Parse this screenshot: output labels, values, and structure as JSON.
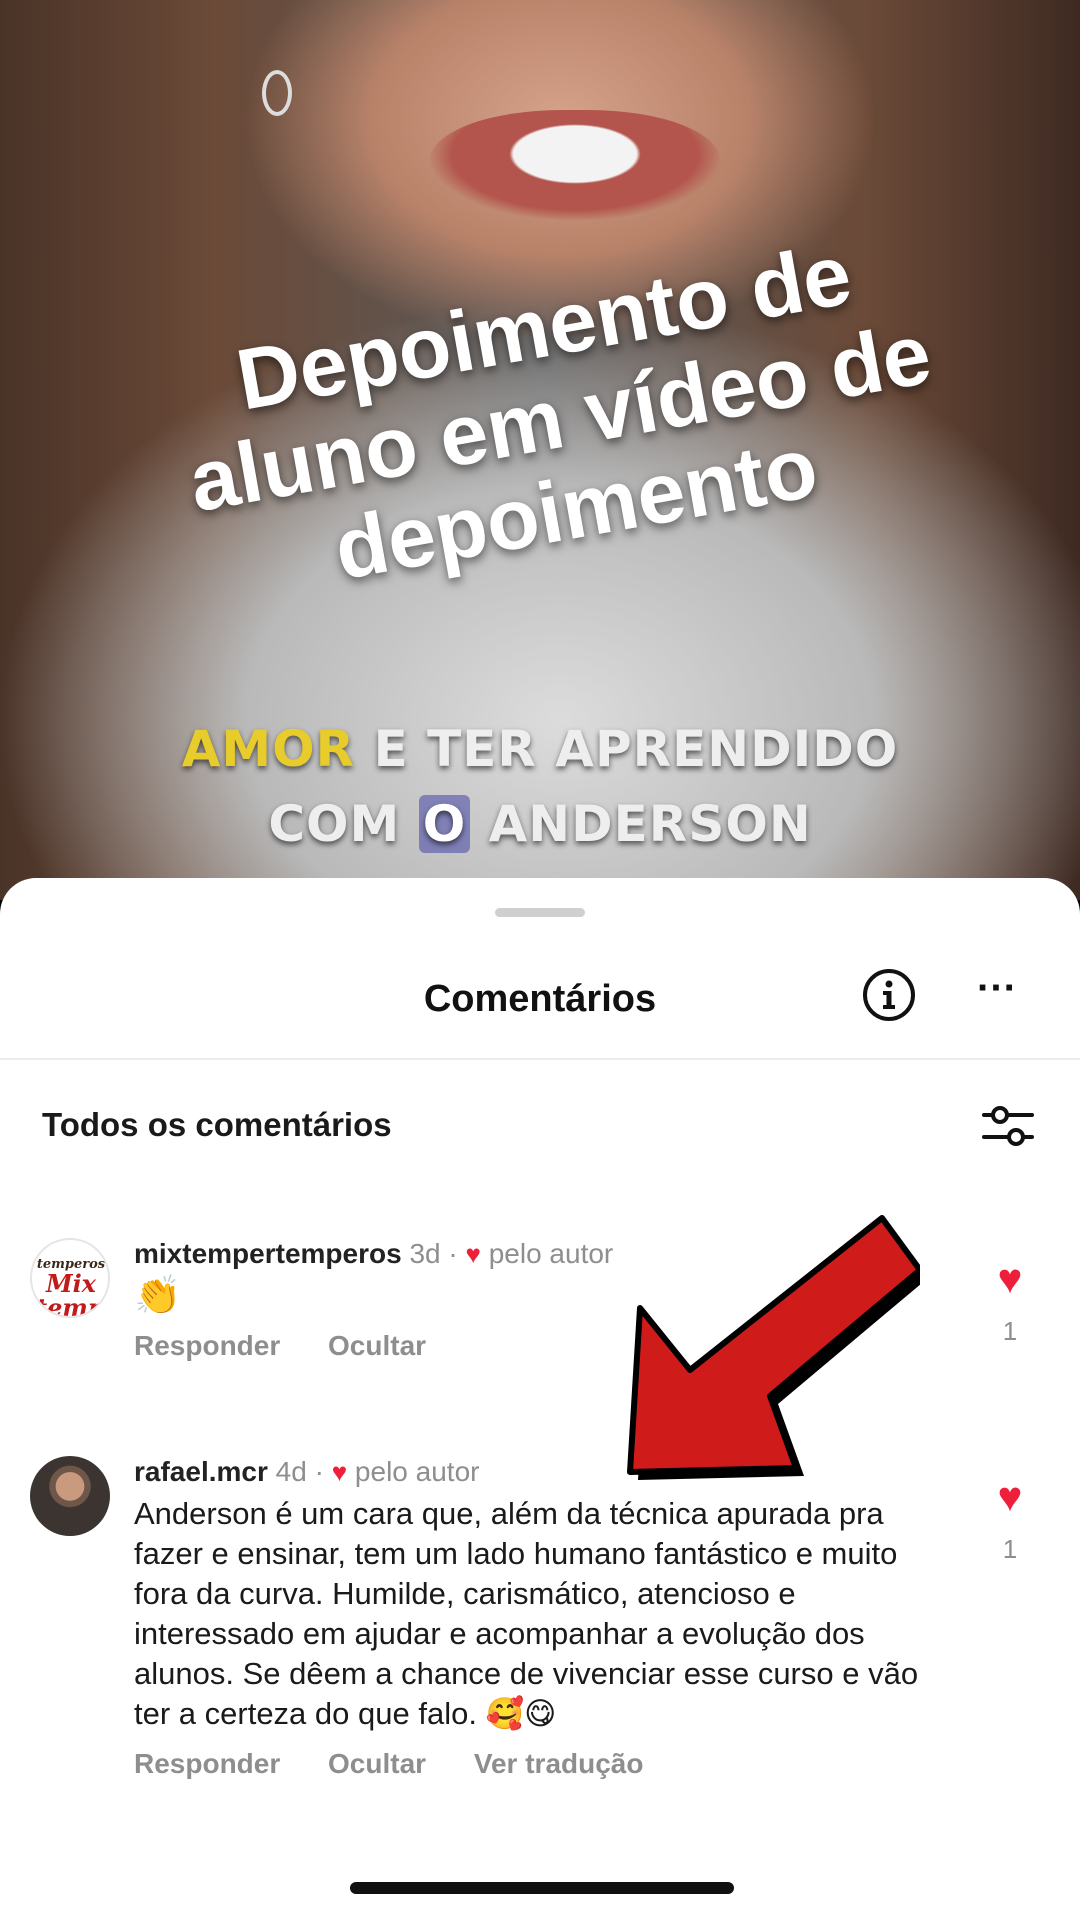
{
  "video": {
    "overlay_title": "Depoimento de\naluno em vídeo de\ndepoimento",
    "caption_line1_highlight": "AMOR",
    "caption_line1_rest": " E TER APRENDIDO",
    "caption_line2_before": "COM ",
    "caption_line2_boxed": "O",
    "caption_line2_after": " ANDERSON",
    "caption_highlight_color": "#e8cc2c"
  },
  "sheet": {
    "title": "Comentários",
    "section_title": "Todos os comentários"
  },
  "comments": [
    {
      "username": "mixtempertemperos",
      "time": "3d",
      "liked_by_author_label": "pelo autor",
      "text": "👏",
      "actions": [
        "Responder",
        "Ocultar"
      ],
      "like_count": "1",
      "avatar_logo_top": "temperos",
      "avatar_logo_main": "Mix\ntemper"
    },
    {
      "username": "rafael.mcr",
      "time": "4d",
      "liked_by_author_label": "pelo autor",
      "text": "Anderson é um cara que, além da técnica apurada pra fazer e ensinar, tem um lado humano fantástico e muito fora da curva. Humilde, carismático, atencioso e interessado em ajudar e acompanhar a evolução dos alunos. Se dêem a chance de vivenciar esse curso e vão ter a certeza do que falo. 🥰😋",
      "actions": [
        "Responder",
        "Ocultar",
        "Ver tradução"
      ],
      "like_count": "1"
    }
  ],
  "icons": {
    "info": "info-icon",
    "more": "more-icon",
    "filter": "filter-icon",
    "heart": "heart-icon",
    "arrow": "red-arrow-icon"
  },
  "colors": {
    "heart": "#ee1f3b",
    "arrow": "#d01b1b"
  }
}
